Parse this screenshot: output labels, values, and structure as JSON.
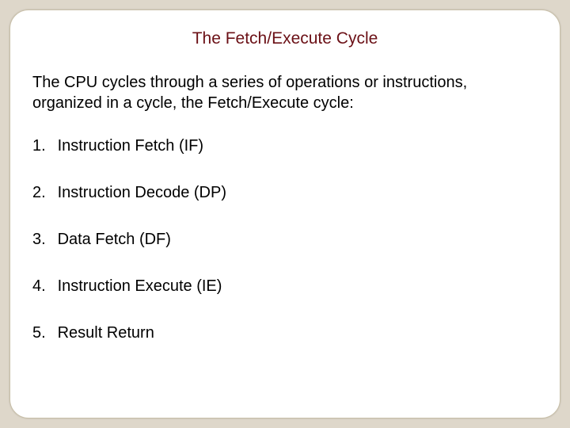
{
  "title": "The Fetch/Execute Cycle",
  "intro": "The CPU cycles through a series of operations or instructions, organized in a cycle, the Fetch/Execute cycle:",
  "steps": [
    {
      "n": "1.",
      "t": "Instruction Fetch (IF)"
    },
    {
      "n": "2.",
      "t": "Instruction Decode (DP)"
    },
    {
      "n": "3.",
      "t": "Data Fetch (DF)"
    },
    {
      "n": "4.",
      "t": "Instruction Execute (IE)"
    },
    {
      "n": "5.",
      "t": "Result Return"
    }
  ]
}
